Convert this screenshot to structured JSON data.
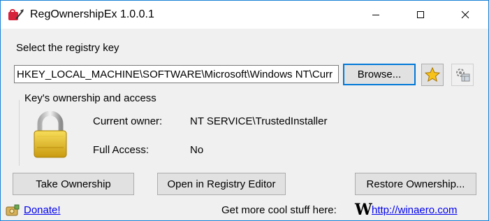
{
  "window": {
    "title": "RegOwnershipEx 1.0.0.1",
    "accent_color": "#1883d7"
  },
  "title_controls": {
    "minimize_icon": "minimize-icon",
    "maximize_icon": "maximize-icon",
    "close_icon": "close-icon"
  },
  "key_selector": {
    "label": "Select the registry key",
    "path_value": "HKEY_LOCAL_MACHINE\\SOFTWARE\\Microsoft\\Windows NT\\Curr",
    "browse_label": "Browse...",
    "favorite_icon": "star-icon",
    "settings_icon": "registry-settings-icon"
  },
  "ownership": {
    "group_label": "Key's ownership and access",
    "lock_icon": "padlock-icon",
    "current_owner_label": "Current owner:",
    "current_owner_value": "NT SERVICE\\TrustedInstaller",
    "full_access_label": "Full Access:",
    "full_access_value": "No"
  },
  "actions": {
    "take_ownership": "Take Ownership",
    "open_regedit": "Open in Registry Editor",
    "restore_ownership": "Restore Ownership..."
  },
  "footer": {
    "donate_label": "Donate!",
    "promo_text": "Get more cool stuff here:",
    "logo_letter": "W",
    "site_link": "http://winaero.com",
    "link_color": "#0000ee"
  }
}
